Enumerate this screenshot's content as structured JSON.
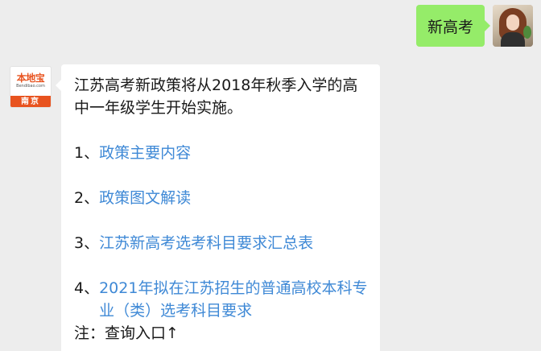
{
  "outgoing": {
    "text": "新高考"
  },
  "incoming": {
    "sender_brand": {
      "logo_text": "本地宝",
      "logo_url_text": "Bendibao.com",
      "city_tag": "南京"
    },
    "intro": "江苏高考新政策将从2018年秋季入学的高中一年级学生开始实施。",
    "items": [
      {
        "num": "1、",
        "link": "政策主要内容"
      },
      {
        "num": "2、",
        "link": "政策图文解读"
      },
      {
        "num": "3、",
        "link": "江苏新高考选考科目要求汇总表"
      },
      {
        "num": "4、",
        "link": "2021年拟在江苏招生的普通高校本科专业（类）选考科目要求"
      }
    ],
    "note": "注：查询入口↑"
  },
  "colors": {
    "chat_background": "#ededed",
    "outgoing_bubble": "#95ec69",
    "incoming_bubble": "#ffffff",
    "link": "#3f89d6",
    "brand_orange": "#e8531f"
  }
}
